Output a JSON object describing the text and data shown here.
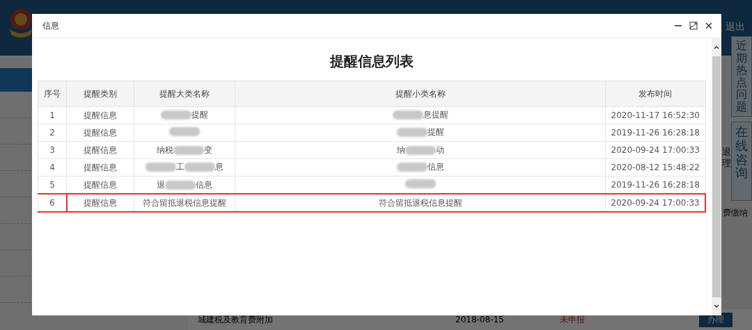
{
  "background": {
    "logout": "退出",
    "hot_topics": "近期热点问题",
    "consult": "在线咨询",
    "tile_labels": [
      "退",
      "理",
      "费缴纳"
    ],
    "row": {
      "name": "城建税及教育费附加",
      "date": "2018-08-15",
      "status": "未申报",
      "action": "办理"
    }
  },
  "dialog": {
    "title": "信息",
    "heading": "提醒信息列表",
    "table": {
      "columns": [
        "序号",
        "提醒类别",
        "提醒大类名称",
        "提醒小类名称",
        "发布时间"
      ],
      "rows": [
        {
          "cells": [
            [
              {
                "kind": "text",
                "text": "1"
              }
            ],
            [
              {
                "kind": "text",
                "text": "提醒信息"
              }
            ],
            [
              {
                "kind": "redaction"
              },
              {
                "kind": "text",
                "text": "提醒"
              }
            ],
            [
              {
                "kind": "redaction"
              },
              {
                "kind": "text",
                "text": "息提醒"
              }
            ],
            [
              {
                "kind": "text",
                "text": "2020-11-17 16:52:30"
              }
            ]
          ],
          "highlighted": false
        },
        {
          "cells": [
            [
              {
                "kind": "text",
                "text": "2"
              }
            ],
            [
              {
                "kind": "text",
                "text": "提醒信息"
              }
            ],
            [
              {
                "kind": "redaction"
              }
            ],
            [
              {
                "kind": "redaction"
              },
              {
                "kind": "text",
                "text": "提醒"
              }
            ],
            [
              {
                "kind": "text",
                "text": "2019-11-26 16:28:18"
              }
            ]
          ],
          "highlighted": false
        },
        {
          "cells": [
            [
              {
                "kind": "text",
                "text": "3"
              }
            ],
            [
              {
                "kind": "text",
                "text": "提醒信息"
              }
            ],
            [
              {
                "kind": "text",
                "text": "纳税"
              },
              {
                "kind": "redaction"
              },
              {
                "kind": "text",
                "text": "变"
              }
            ],
            [
              {
                "kind": "text",
                "text": "纳"
              },
              {
                "kind": "redaction"
              },
              {
                "kind": "text",
                "text": "动"
              }
            ],
            [
              {
                "kind": "text",
                "text": "2020-09-24 17:00:33"
              }
            ]
          ],
          "highlighted": false
        },
        {
          "cells": [
            [
              {
                "kind": "text",
                "text": "4"
              }
            ],
            [
              {
                "kind": "text",
                "text": "提醒信息"
              }
            ],
            [
              {
                "kind": "redaction"
              },
              {
                "kind": "text",
                "text": "工"
              },
              {
                "kind": "redaction"
              },
              {
                "kind": "text",
                "text": "息"
              }
            ],
            [
              {
                "kind": "redaction"
              },
              {
                "kind": "text",
                "text": "信息"
              }
            ],
            [
              {
                "kind": "text",
                "text": "2020-08-12 15:48:22"
              }
            ]
          ],
          "highlighted": false
        },
        {
          "cells": [
            [
              {
                "kind": "text",
                "text": "5"
              }
            ],
            [
              {
                "kind": "text",
                "text": "提醒信息"
              }
            ],
            [
              {
                "kind": "text",
                "text": "退"
              },
              {
                "kind": "redaction"
              },
              {
                "kind": "text",
                "text": "信息"
              }
            ],
            [
              {
                "kind": "redaction"
              }
            ],
            [
              {
                "kind": "text",
                "text": "2019-11-26 16:28:18"
              }
            ]
          ],
          "highlighted": false
        },
        {
          "cells": [
            [
              {
                "kind": "text",
                "text": "6"
              }
            ],
            [
              {
                "kind": "text",
                "text": "提醒信息"
              }
            ],
            [
              {
                "kind": "text",
                "text": "符合留抵退税信息提醒"
              }
            ],
            [
              {
                "kind": "text",
                "text": "符合留抵退税信息提醒"
              }
            ],
            [
              {
                "kind": "text",
                "text": "2020-09-24 17:00:33"
              }
            ]
          ],
          "highlighted": true
        }
      ]
    }
  }
}
